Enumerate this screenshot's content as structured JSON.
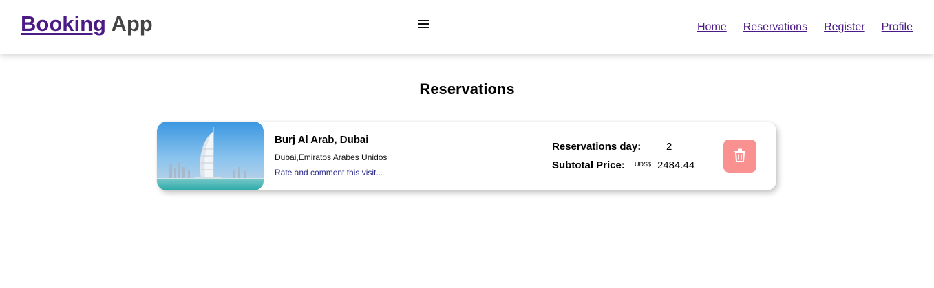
{
  "header": {
    "brand_main": "Booking",
    "brand_sub": " App",
    "nav": [
      {
        "label": "Home"
      },
      {
        "label": "Reservations"
      },
      {
        "label": "Register"
      },
      {
        "label": "Profile"
      }
    ],
    "menu_icon": "hamburger-menu-icon"
  },
  "main": {
    "title": "Reservations",
    "reservations": [
      {
        "hotel_name": "Burj Al Arab, Dubai",
        "location": "Dubai,Emiratos Arabes Unidos",
        "rate_link": "Rate and comment this visit...",
        "days_label": "Reservations day:",
        "days_value": "2",
        "price_label": "Subtotal Price:",
        "currency": "UDS$",
        "price_value": "2484.44",
        "delete_icon": "trash-icon"
      }
    ]
  },
  "colors": {
    "brand": "#4b1a86",
    "delete_button": "#f8918f",
    "rate_link": "#2b2a8a"
  }
}
